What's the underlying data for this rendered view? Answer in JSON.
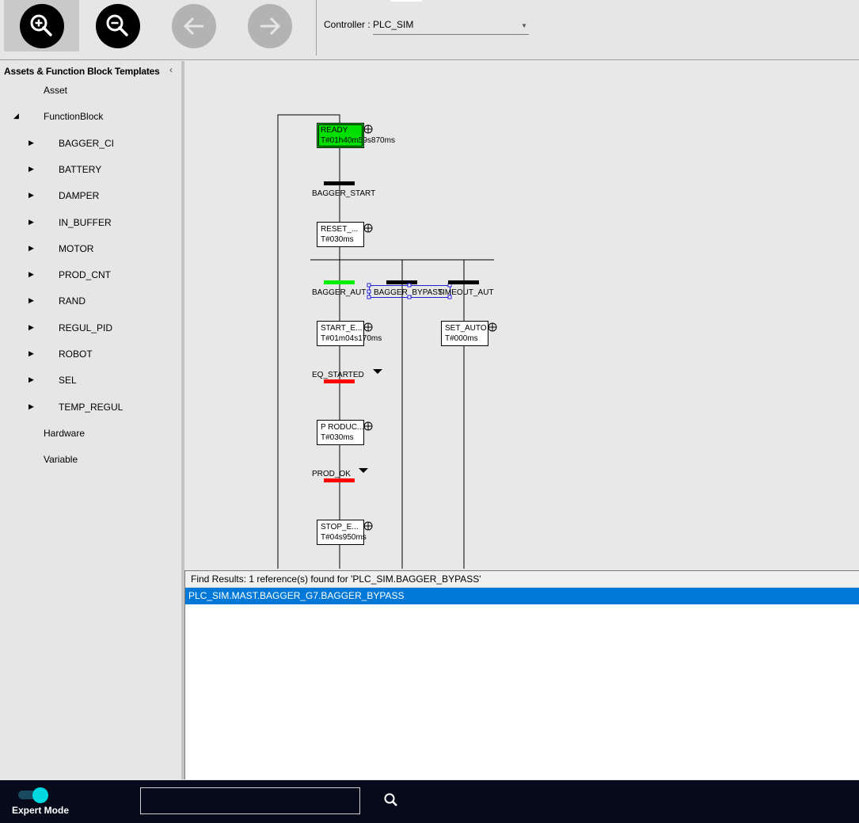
{
  "toolbar": {
    "buttons": [
      {
        "name": "zoom-in",
        "icon": "zoom-in-icon",
        "enabled": true,
        "active": true
      },
      {
        "name": "zoom-out",
        "icon": "zoom-out-icon",
        "enabled": true
      },
      {
        "name": "back",
        "icon": "arrow-left-icon",
        "enabled": false
      },
      {
        "name": "forward",
        "icon": "arrow-right-icon",
        "enabled": false
      }
    ],
    "controller_label": "Controller :",
    "controller_value": "PLC_SIM"
  },
  "sidebar": {
    "title": "Assets & Function Block Templates",
    "items": [
      {
        "label": "Asset",
        "level": 0
      },
      {
        "label": "FunctionBlock",
        "level": 0,
        "expanded": true
      },
      {
        "label": "BAGGER_CI",
        "level": 1
      },
      {
        "label": "BATTERY",
        "level": 1
      },
      {
        "label": "DAMPER",
        "level": 1
      },
      {
        "label": "IN_BUFFER",
        "level": 1
      },
      {
        "label": "MOTOR",
        "level": 1
      },
      {
        "label": "PROD_CNT",
        "level": 1
      },
      {
        "label": "RAND",
        "level": 1
      },
      {
        "label": "REGUL_PID",
        "level": 1
      },
      {
        "label": "ROBOT",
        "level": 1
      },
      {
        "label": "SEL",
        "level": 1
      },
      {
        "label": "TEMP_REGUL",
        "level": 1
      },
      {
        "label": "Hardware",
        "level": 0
      },
      {
        "label": "Variable",
        "level": 0
      }
    ]
  },
  "diagram": {
    "steps": [
      {
        "name": "READY",
        "time": "T#01h40m59s870ms",
        "active": true
      },
      {
        "name": "RESET_...",
        "time": "T#030ms"
      },
      {
        "name": "START_E...",
        "time": "T#01m04s170ms"
      },
      {
        "name": "SET_AUTO",
        "time": "T#000ms"
      },
      {
        "name": "P RODUC...",
        "time": "T#030ms"
      },
      {
        "name": "STOP_E...",
        "time": "T#04s950ms"
      }
    ],
    "transitions": [
      {
        "name": "BAGGER_START",
        "state": "inactive"
      },
      {
        "name": "BAGGER_AUT",
        "state": "true"
      },
      {
        "name": "BAGGER_BYPASS",
        "state": "inactive",
        "selected": true
      },
      {
        "name": "TIMEOUT_AUT",
        "state": "inactive"
      },
      {
        "name": "EQ_STARTED",
        "state": "false"
      },
      {
        "name": "PROD_OK",
        "state": "false"
      }
    ],
    "colors": {
      "active_step": "#00e000",
      "true": "#00ee00",
      "false": "#ff0000",
      "inactive": "#000000",
      "selection": "#2020d0"
    }
  },
  "find": {
    "header": "Find Results: 1 reference(s) found for 'PLC_SIM.BAGGER_BYPASS'",
    "results": [
      "PLC_SIM.MAST.BAGGER_G7.BAGGER_BYPASS"
    ]
  },
  "bottom": {
    "expert_mode_label": "Expert Mode",
    "expert_mode_on": true,
    "search_value": ""
  }
}
